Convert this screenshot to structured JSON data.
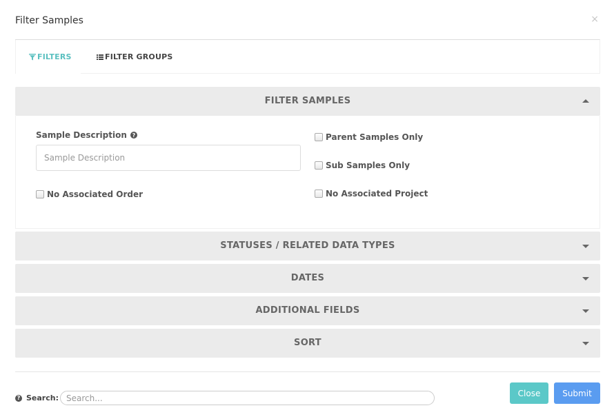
{
  "modal": {
    "title": "Filter Samples",
    "close_glyph": "×"
  },
  "tabs": [
    {
      "label": "FILTERS",
      "icon": "filter-icon",
      "active": true
    },
    {
      "label": "FILTER GROUPS",
      "icon": "list-icon",
      "active": false
    }
  ],
  "panels": {
    "filter_samples": {
      "title": "FILTER SAMPLES",
      "expanded": true
    },
    "statuses": {
      "title": "STATUSES / RELATED DATA TYPES",
      "expanded": false
    },
    "dates": {
      "title": "DATES",
      "expanded": false
    },
    "additional_fields": {
      "title": "ADDITIONAL FIELDS",
      "expanded": false
    },
    "sort": {
      "title": "SORT",
      "expanded": false
    }
  },
  "filter_fields": {
    "sample_description_label": "Sample Description",
    "sample_description_placeholder": "Sample Description",
    "sample_description_value": "",
    "no_associated_order": "No Associated Order",
    "parent_samples_only": "Parent Samples Only",
    "sub_samples_only": "Sub Samples Only",
    "no_associated_project": "No Associated Project"
  },
  "footer": {
    "search_label": "Search:",
    "search_placeholder": "Search...",
    "close_label": "Close",
    "submit_label": "Submit"
  },
  "colors": {
    "accent_teal": "#5bc8c8",
    "accent_blue": "#5a9cf0",
    "panel_bg": "#ebebeb"
  }
}
